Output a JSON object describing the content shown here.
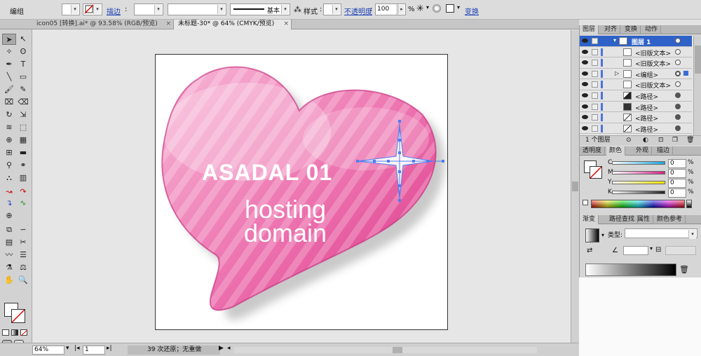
{
  "control_bar": {
    "selection_label": "编组",
    "stroke_link": "描边",
    "stroke_profile": "基本",
    "style_label": "样式",
    "opacity_link": "不透明度",
    "opacity_value": "100",
    "opacity_unit": "%",
    "transform_link": "变换"
  },
  "tabs": [
    {
      "label": "icon05 [转换].ai* @ 93.58% (RGB/预览)",
      "close": "×"
    },
    {
      "label": "未标题-30* @ 64% (CMYK/预览)",
      "close": "×"
    }
  ],
  "artwork": {
    "title": "ASADAL 01",
    "line1": "hosting",
    "line2": "domain"
  },
  "status_bar": {
    "zoom": "64%",
    "page": "1",
    "history": "39 次还原；无重做"
  },
  "panels": {
    "layers_tabs": [
      "图层",
      "对齐",
      "变换",
      "动作"
    ],
    "layers": [
      {
        "name": "图层 1",
        "selected": true
      },
      {
        "name": "<旧版文本>"
      },
      {
        "name": "<旧版文本>"
      },
      {
        "name": "<编组>"
      },
      {
        "name": "<旧版文本>"
      },
      {
        "name": "<路径>"
      },
      {
        "name": "<路径>"
      },
      {
        "name": "<路径>"
      },
      {
        "name": "<路径>"
      }
    ],
    "layers_footer": "1 个图层",
    "color_tabs": [
      "透明度",
      "颜色",
      "外观",
      "描边"
    ],
    "color_sliders": [
      {
        "label": "C",
        "value": "0",
        "color": "#19a9e0"
      },
      {
        "label": "M",
        "value": "0",
        "color": "#d81f86"
      },
      {
        "label": "Y",
        "value": "0",
        "color": "#f2e200"
      },
      {
        "label": "K",
        "value": "0",
        "color": "#222222"
      }
    ],
    "gradient_tabs": [
      "渐变",
      "路径查找",
      "属性",
      "颜色参考"
    ],
    "gradient_type_label": "类型:"
  },
  "colors": {
    "heart_main": "#e2519a",
    "heart_light": "#f6b3d3",
    "selection_blue": "#4f7df0"
  }
}
